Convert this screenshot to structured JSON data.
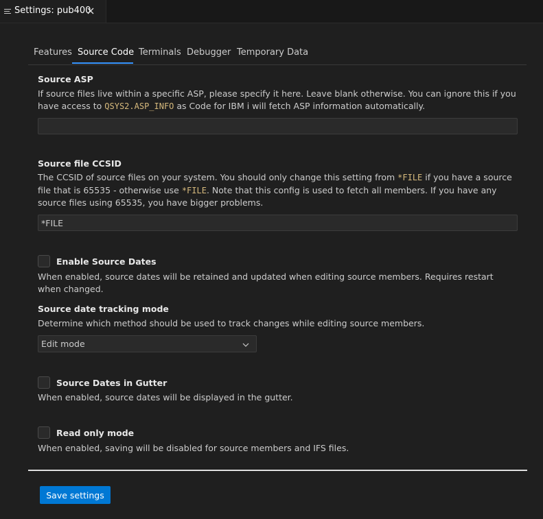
{
  "editor_tab": {
    "title": "Settings: pub400"
  },
  "nav_tabs": [
    "Features",
    "Source Code",
    "Terminals",
    "Debugger",
    "Temporary Data"
  ],
  "source_asp": {
    "label": "Source ASP",
    "desc_1": "If source files live within a specific ASP, please specify it here. Leave blank otherwise. You can ignore this if you have access to ",
    "desc_code": "QSYS2.ASP_INFO",
    "desc_2": " as Code for IBM i will fetch ASP information automatically.",
    "value": ""
  },
  "source_ccsid": {
    "label": "Source file CCSID",
    "desc_1": "The CCSID of source files on your system. You should only change this setting from ",
    "desc_code_1": "*FILE",
    "desc_2": " if you have a source file that is 65535 - otherwise use ",
    "desc_code_2": "*FILE",
    "desc_3": ". Note that this config is used to fetch all members. If you have any source files using 65535, you have bigger problems.",
    "value": "*FILE"
  },
  "enable_source_dates": {
    "label": "Enable Source Dates",
    "desc": "When enabled, source dates will be retained and updated when editing source members. Requires restart when changed.",
    "checked": false
  },
  "tracking_mode": {
    "label": "Source date tracking mode",
    "desc": "Determine which method should be used to track changes while editing source members.",
    "selected": "Edit mode"
  },
  "source_dates_gutter": {
    "label": "Source Dates in Gutter",
    "desc": "When enabled, source dates will be displayed in the gutter.",
    "checked": false
  },
  "read_only": {
    "label": "Read only mode",
    "desc": "When enabled, saving will be disabled for source members and IFS files.",
    "checked": false
  },
  "save_button": {
    "label": "Save settings"
  },
  "colors": {
    "accent": "#3794ff",
    "button": "#0078d4",
    "code": "#d7ba7d",
    "background": "#1f1f1f"
  }
}
